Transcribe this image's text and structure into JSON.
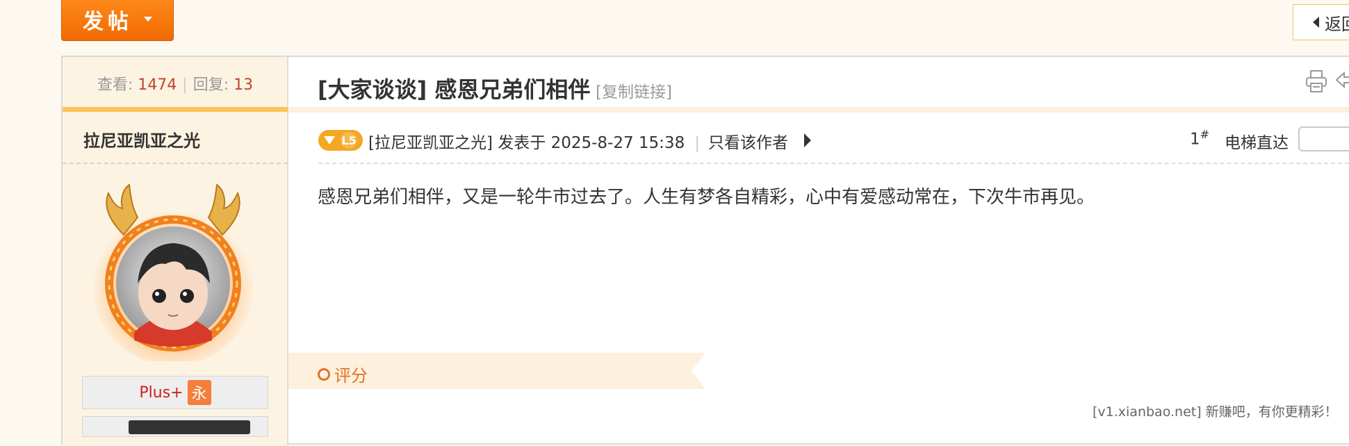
{
  "toolbar": {
    "post_button_label": "发帖",
    "back_button_label": "返回"
  },
  "thread": {
    "stats": {
      "views_label": "查看:",
      "views_value": "1474",
      "replies_label": "回复:",
      "replies_value": "13"
    },
    "title": "[大家谈谈] 感恩兄弟们相伴",
    "copy_link_label": "[复制链接]"
  },
  "author": {
    "name": "拉尼亚凯亚之光",
    "level_badge": "L5",
    "badge_plus_label": "Plus+",
    "badge_plus_suffix": "永"
  },
  "post": {
    "author_link": "[拉尼亚凯亚之光]",
    "posted_at": "发表于 2025-8-27 15:38",
    "only_author_label": "只看该作者",
    "floor_number": "1",
    "floor_suffix": "#",
    "elevator_label": "电梯直达",
    "body": "感恩兄弟们相伴，又是一轮牛市过去了。人生有梦各自精彩，心中有爱感动常在，下次牛市再见。",
    "rating_label": "评分"
  },
  "footer": {
    "signature": "[v1.xianbao.net] 新赚吧，有你更精彩！"
  },
  "colors": {
    "accent_orange": "#f06a00",
    "stat_number": "#c0452b",
    "rating_orange": "#e0722a"
  },
  "icons": [
    "caret-down-icon",
    "triangle-left-icon",
    "print-icon",
    "reply-arrow-icon",
    "diamond-level-icon",
    "triangle-right-icon",
    "rating-circle-icon"
  ]
}
